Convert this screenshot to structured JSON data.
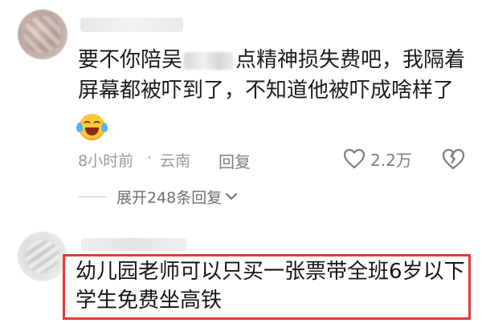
{
  "comments": [
    {
      "text_line1_part1": "要不你陪吴",
      "text_line1_part2": "点精神损失费吧，我隔着",
      "text_line2": "屏幕都被吓到了，不知道他被吓成啥样了",
      "emoji": "laughing-crying-emoji",
      "time": "8小时前",
      "dot": "·",
      "location": "云南",
      "reply_label": "回复",
      "like_count": "2.2万",
      "expand_label": "展开248条回复"
    },
    {
      "text_line1": "幼儿园老师可以只买一张票带全班6岁以下",
      "text_line2": "学生免费坐高铁",
      "highlight_color": "#e53a36"
    }
  ]
}
